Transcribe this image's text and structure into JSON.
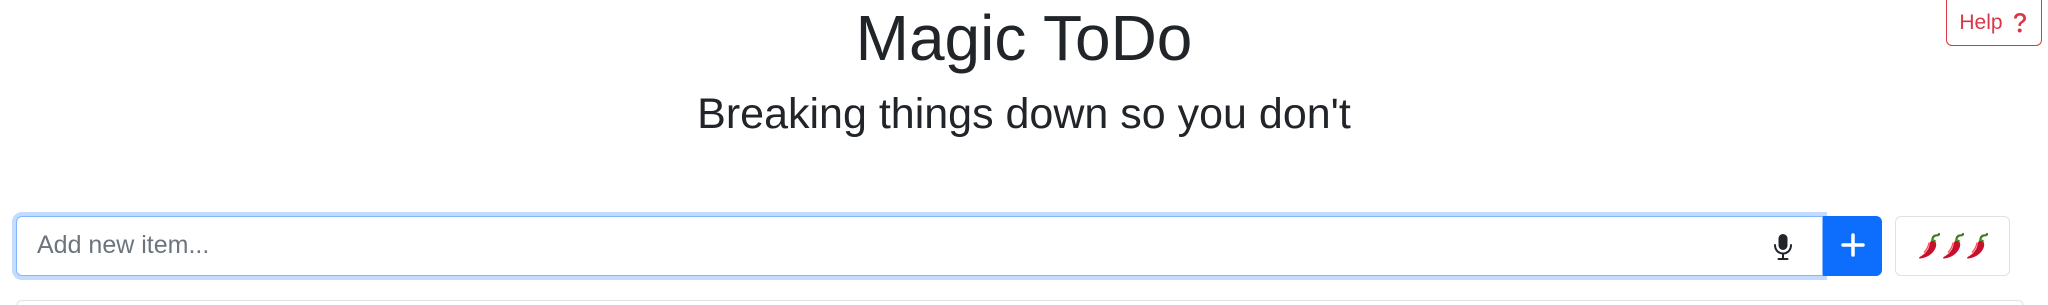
{
  "header": {
    "title": "Magic ToDo",
    "subtitle": "Breaking things down so you don't"
  },
  "help": {
    "label": "Help",
    "icon": "question-icon"
  },
  "new_item": {
    "placeholder": "Add new item...",
    "value": "",
    "mic_icon": "microphone-icon",
    "add_icon": "plus-icon"
  },
  "spiciness": {
    "level": 3,
    "max": 3,
    "icon": "chili-pepper-icon"
  },
  "colors": {
    "help_accent": "#dc3545",
    "primary": "#0d6efd",
    "focus_ring": "#86b7fe",
    "border": "#dee2e6",
    "text": "#212529"
  }
}
